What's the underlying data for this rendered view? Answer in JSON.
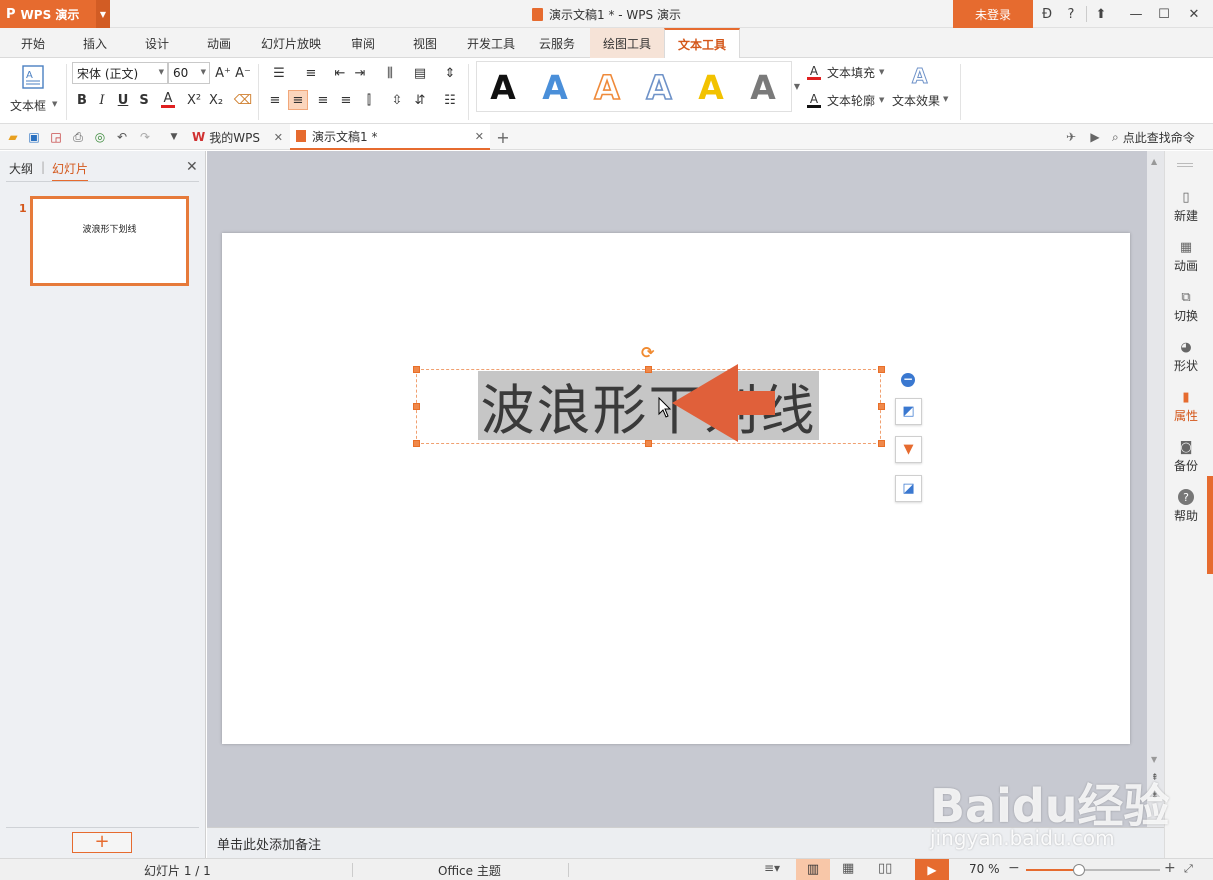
{
  "app": {
    "name": "WPS 演示",
    "logo_glyph": "P",
    "document_title": "演示文稿1 * - WPS 演示",
    "login_label": "未登录"
  },
  "menu_tabs": [
    "开始",
    "插入",
    "设计",
    "动画",
    "幻灯片放映",
    "审阅",
    "视图",
    "开发工具",
    "云服务",
    "绘图工具",
    "文本工具"
  ],
  "active_tab": "文本工具",
  "ribbon": {
    "textbox_label": "文本框",
    "font_name": "宋体 (正文)",
    "font_size": "60",
    "wordart_letter": "A",
    "wordart_colors": [
      "#111111",
      "#4a8fd9",
      "#ef8a3a",
      "#6e92c8",
      "#f2c200",
      "#7a7a7a"
    ],
    "text_fill_label": "文本填充",
    "text_outline_label": "文本轮廓",
    "text_effect_label": "文本效果"
  },
  "quickbar": {
    "my_wps_tab": "我的WPS",
    "doc_tab": "演示文稿1 *",
    "search_label": "点此查找命令"
  },
  "left_panel": {
    "tab_outline": "大纲",
    "tab_slides": "幻灯片",
    "active_tab": "幻灯片",
    "slide_number": "1",
    "thumbnail_text": "波浪形下划线"
  },
  "slide": {
    "text": "波浪形下划线"
  },
  "notes_placeholder": "单击此处添加备注",
  "right_sidebar": [
    {
      "label": "新建",
      "icon": "new-icon"
    },
    {
      "label": "动画",
      "icon": "animation-icon"
    },
    {
      "label": "切换",
      "icon": "transition-icon"
    },
    {
      "label": "形状",
      "icon": "shape-icon"
    },
    {
      "label": "属性",
      "icon": "properties-icon"
    },
    {
      "label": "备份",
      "icon": "backup-icon"
    },
    {
      "label": "帮助",
      "icon": "help-icon"
    }
  ],
  "status": {
    "slide_counter": "幻灯片 1 / 1",
    "theme": "Office 主题",
    "zoom": "70 %",
    "zoom_percent": 70
  },
  "watermark": {
    "brand": "Baidu经验",
    "url": "jingyan.baidu.com"
  },
  "colors": {
    "accent": "#e66b2f",
    "arrow": "#e0603a",
    "selection": "#c6c6c6"
  }
}
